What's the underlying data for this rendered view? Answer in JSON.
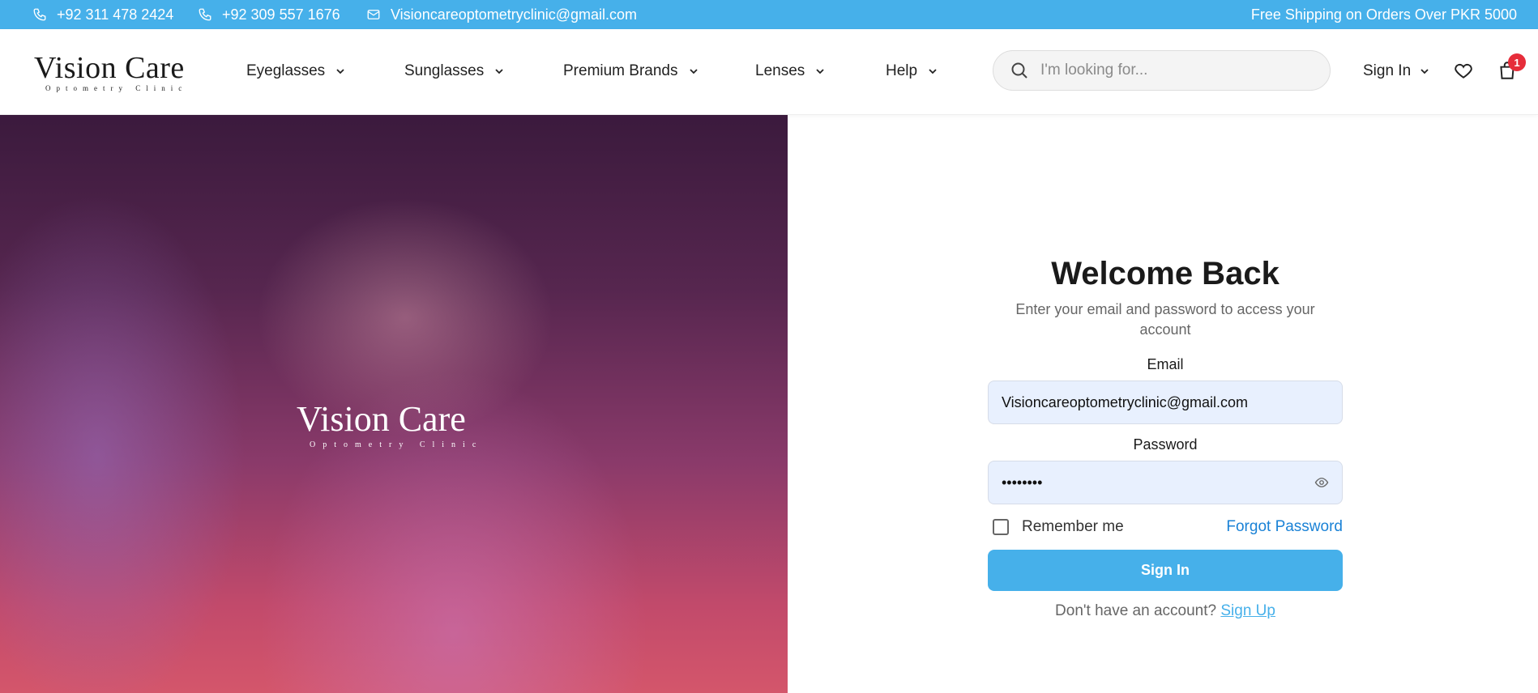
{
  "topbar": {
    "phone1": "+92 311 478 2424",
    "phone2": "+92 309 557 1676",
    "email": "Visioncareoptometryclinic@gmail.com",
    "shipping": "Free Shipping on Orders Over PKR 5000",
    "background_color": "#46b0ea"
  },
  "header": {
    "logo_main": "Vision Care",
    "logo_sub": "Optometry Clinic",
    "nav": [
      {
        "label": "Eyeglasses"
      },
      {
        "label": "Sunglasses"
      },
      {
        "label": "Premium Brands"
      },
      {
        "label": "Lenses"
      },
      {
        "label": "Help"
      }
    ],
    "search_placeholder": "I'm looking for...",
    "signin_label": "Sign In",
    "cart_count": "1"
  },
  "hero": {
    "logo_main": "Vision Care",
    "logo_sub": "Optometry Clinic"
  },
  "login": {
    "title": "Welcome Back",
    "subtitle": "Enter your email and password to access your account",
    "email_label": "Email",
    "email_value": "Visioncareoptometryclinic@gmail.com",
    "password_label": "Password",
    "password_value": "••••••••",
    "remember_label": "Remember me",
    "forgot_label": "Forgot Password",
    "signin_button": "Sign In",
    "signup_prompt": "Don't have an account?",
    "signup_link": "Sign Up",
    "accent_color": "#46b0ea"
  }
}
